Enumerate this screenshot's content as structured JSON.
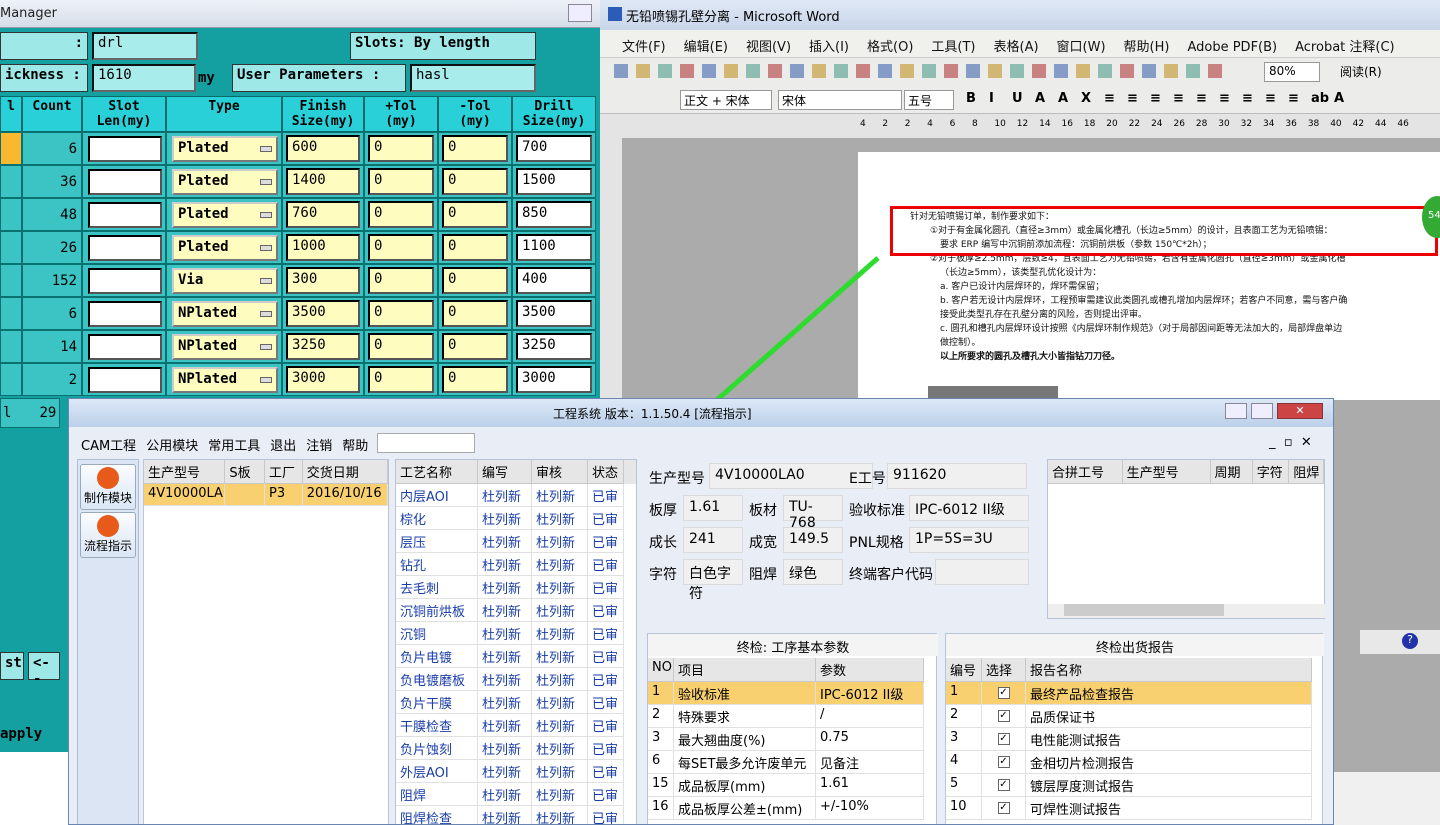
{
  "drill": {
    "title": "Manager",
    "layer_value": "drl",
    "slots_label": "Slots:",
    "slots_value": "By length",
    "thickness_label": "ickness :",
    "thickness_value": "1610",
    "unit": "my",
    "userparams_label": "User Parameters :",
    "userparams_value": "hasl",
    "headers": [
      "l",
      "Count",
      "Slot\nLen(my)",
      "Type",
      "Finish\nSize(my)",
      "+Tol\n(my)",
      "-Tol\n(my)",
      "Drill\nSize(my)"
    ],
    "rows": [
      {
        "count": "6",
        "type": "Plated",
        "finish": "600",
        "ptol": "0",
        "mtol": "0",
        "drill": "700"
      },
      {
        "count": "36",
        "type": "Plated",
        "finish": "1400",
        "ptol": "0",
        "mtol": "0",
        "drill": "1500"
      },
      {
        "count": "48",
        "type": "Plated",
        "finish": "760",
        "ptol": "0",
        "mtol": "0",
        "drill": "850"
      },
      {
        "count": "26",
        "type": "Plated",
        "finish": "1000",
        "ptol": "0",
        "mtol": "0",
        "drill": "1100"
      },
      {
        "count": "152",
        "type": "Via",
        "finish": "300",
        "ptol": "0",
        "mtol": "0",
        "drill": "400"
      },
      {
        "count": "6",
        "type": "NPlated",
        "finish": "3500",
        "ptol": "0",
        "mtol": "0",
        "drill": "3500"
      },
      {
        "count": "14",
        "type": "NPlated",
        "finish": "3250",
        "ptol": "0",
        "mtol": "0",
        "drill": "3250"
      },
      {
        "count": "2",
        "type": "NPlated",
        "finish": "3000",
        "ptol": "0",
        "mtol": "0",
        "drill": "3000"
      }
    ],
    "total_left": "l",
    "total_count": "29",
    "btn_st": "st",
    "btn_back": "<--",
    "btn_apply": "apply"
  },
  "word": {
    "title": "无铅喷锡孔壁分离 - Microsoft Word",
    "menu": [
      "文件(F)",
      "编辑(E)",
      "视图(V)",
      "插入(I)",
      "格式(O)",
      "工具(T)",
      "表格(A)",
      "窗口(W)",
      "帮助(H)",
      "Adobe PDF(B)",
      "Acrobat 注释(C)"
    ],
    "zoom": "80%",
    "read": "阅读(R)",
    "style": "正文 + 宋体",
    "font": "宋体",
    "size": "五号",
    "ruler": [
      "4",
      "2",
      "2",
      "4",
      "6",
      "8",
      "10",
      "12",
      "14",
      "16",
      "18",
      "20",
      "22",
      "24",
      "26",
      "28",
      "30",
      "32",
      "34",
      "36",
      "38",
      "40",
      "42",
      "44",
      "46"
    ],
    "lines": [
      "针对无铅喷锡订单，制作要求如下：",
      "①对于有金属化圆孔（直径≥3mm）或金属化槽孔（长边≥5mm）的设计，且表面工艺为无铅喷锡：",
      "要求 ERP 编写中沉铜前添加流程：沉铜前烘板（参数 150℃*2h）；",
      "②对于板厚≥2.5mm，层数≥4，且表面工艺为无铅喷锡，若含有金属化圆孔（直径≥3mm）或金属化槽",
      "（长边≥5mm），该类型孔优化设计为：",
      "a. 客户已设计内层焊环的，焊环需保留；",
      "b. 客户若无设计内层焊环，工程预审需建议此类圆孔或槽孔增加内层焊环；若客户不同意，需与客户确",
      "接受此类型孔存在孔壁分离的风险，否则提出评审。",
      "c. 圆孔和槽孔内层焊环设计按照《内层焊环制作规范》（对于局部因间距等无法加大的，局部焊盘单边",
      "做控制）。",
      "以上所要求的圆孔及槽孔大小皆指钻刀刀径。"
    ],
    "badge": "54"
  },
  "eng": {
    "title": "工程系统  版本：1.1.50.4  [流程指示]",
    "menu": [
      "CAM工程",
      "公用模块",
      "常用工具",
      "退出",
      "注销",
      "帮助"
    ],
    "side_btn1": "制作模块",
    "side_btn2": "流程指示",
    "order_headers": [
      "生产型号",
      "S板",
      "工厂",
      "交货日期"
    ],
    "order_row": [
      "4V10000LA0",
      "",
      "P3",
      "2016/10/16"
    ],
    "proc_headers": [
      "工艺名称",
      "编写",
      "审核",
      "状态"
    ],
    "procs": [
      [
        "内层AOI",
        "杜列新",
        "杜列新",
        "已审"
      ],
      [
        "棕化",
        "杜列新",
        "杜列新",
        "已审"
      ],
      [
        "层压",
        "杜列新",
        "杜列新",
        "已审"
      ],
      [
        "钻孔",
        "杜列新",
        "杜列新",
        "已审"
      ],
      [
        "去毛刺",
        "杜列新",
        "杜列新",
        "已审"
      ],
      [
        "沉铜前烘板",
        "杜列新",
        "杜列新",
        "已审"
      ],
      [
        "沉铜",
        "杜列新",
        "杜列新",
        "已审"
      ],
      [
        "负片电镀",
        "杜列新",
        "杜列新",
        "已审"
      ],
      [
        "负电镀磨板",
        "杜列新",
        "杜列新",
        "已审"
      ],
      [
        "负片干膜",
        "杜列新",
        "杜列新",
        "已审"
      ],
      [
        "干膜检查",
        "杜列新",
        "杜列新",
        "已审"
      ],
      [
        "负片蚀刻",
        "杜列新",
        "杜列新",
        "已审"
      ],
      [
        "外层AOI",
        "杜列新",
        "杜列新",
        "已审"
      ],
      [
        "阻焊",
        "杜列新",
        "杜列新",
        "已审"
      ],
      [
        "阻焊检查",
        "杜列新",
        "杜列新",
        "已审"
      ]
    ],
    "info": {
      "pn_label": "生产型号",
      "pn": "4V10000LA0",
      "e_label": "E工号",
      "e": "911620",
      "thick_label": "板厚",
      "thick": "1.61",
      "mat_label": "板材",
      "mat": "TU-768",
      "std_label": "验收标准",
      "std": "IPC-6012 II级",
      "len_label": "成长",
      "len": "241",
      "wid_label": "成宽",
      "wid": "149.5",
      "pnl_label": "PNL规格",
      "pnl": "1P=5S=3U",
      "char_label": "字符",
      "char": "白色字符",
      "sm_label": "阻焊",
      "sm": "绿色",
      "cust_label": "终端客户代码",
      "cust": ""
    },
    "combine_headers": [
      "合拼工号",
      "生产型号",
      "周期",
      "字符",
      "阻焊"
    ],
    "params_title": "终检: 工序基本参数",
    "params_headers": [
      "NO",
      "项目",
      "参数"
    ],
    "params": [
      [
        "1",
        "验收标准",
        "IPC-6012 II级"
      ],
      [
        "2",
        "特殊要求",
        "/"
      ],
      [
        "3",
        "最大翘曲度(%)",
        "0.75"
      ],
      [
        "6",
        "每SET最多允许废单元",
        "见备注"
      ],
      [
        "15",
        "成品板厚(mm)",
        "1.61"
      ],
      [
        "16",
        "成品板厚公差±(mm)",
        "+/-10%"
      ]
    ],
    "report_title": "终检出货报告",
    "report_headers": [
      "编号",
      "选择",
      "报告名称"
    ],
    "reports": [
      [
        "1",
        "最终产品检查报告"
      ],
      [
        "2",
        "品质保证书"
      ],
      [
        "3",
        "电性能测试报告"
      ],
      [
        "4",
        "金相切片检测报告"
      ],
      [
        "5",
        "镀层厚度测试报告"
      ],
      [
        "10",
        "可焊性测试报告"
      ]
    ]
  }
}
